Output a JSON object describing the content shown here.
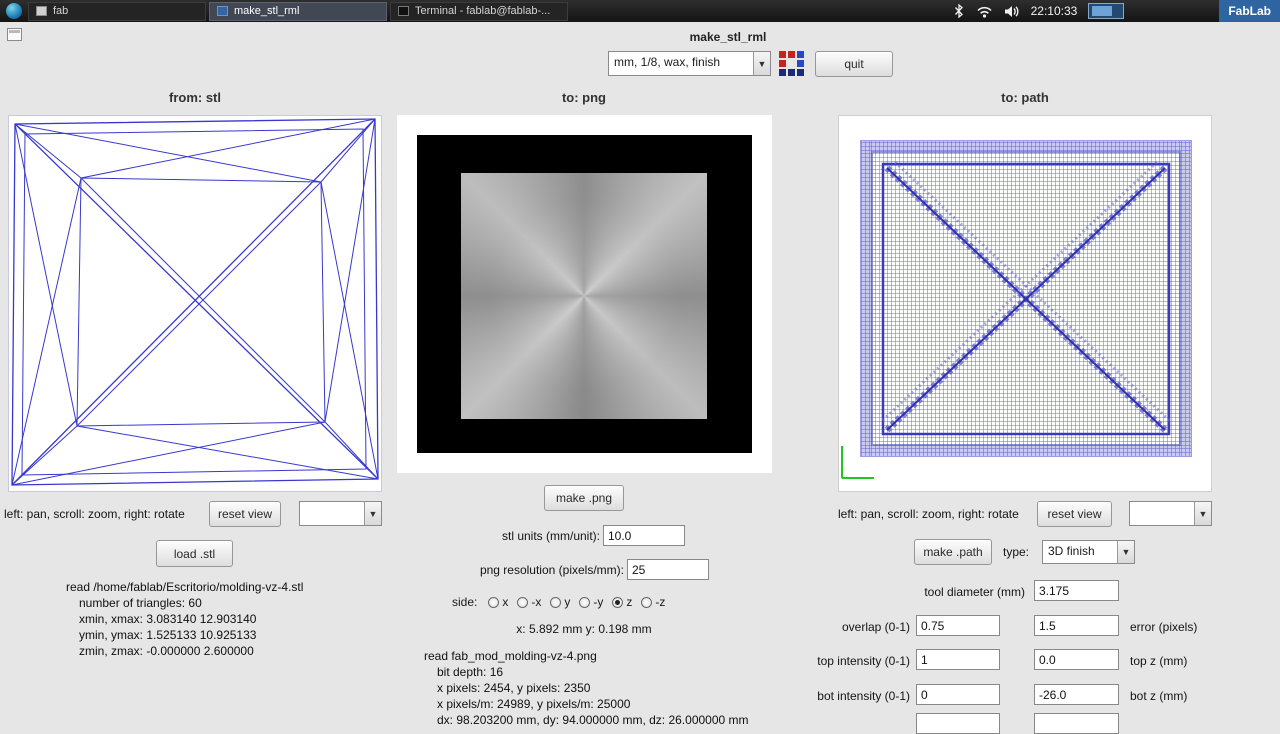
{
  "colors": {
    "accent": "#3465a4",
    "wireframe_blue": "#2323c8",
    "path_blue": "#4a4ac8",
    "selection_blue": "#4a90d9"
  },
  "taskbar": {
    "windows": [
      {
        "label": "fab"
      },
      {
        "label": "make_stl_rml"
      },
      {
        "label": "Terminal - fablab@fablab-..."
      }
    ],
    "clock": "22:10:33",
    "badge": "FabLab"
  },
  "window": {
    "title": "make_stl_rml",
    "preset_value": "mm, 1/8, wax, finish",
    "quit_label": "quit"
  },
  "stl": {
    "header": "from: stl",
    "hint": "left: pan, scroll: zoom, right: rotate",
    "reset_label": "reset view",
    "view_preset_value": "",
    "load_label": "load .stl",
    "info": [
      "read /home/fablab/Escritorio/molding-vz-4.stl",
      "number of triangles: 60",
      "xmin, xmax: 3.083140 12.903140",
      "ymin, ymax: 1.525133 10.925133",
      "zmin, zmax: -0.000000 2.600000"
    ]
  },
  "png": {
    "header": "to: png",
    "make_label": "make .png",
    "units_label": "stl units (mm/unit):",
    "units_value": "10.0",
    "resolution_label": "png resolution (pixels/mm):",
    "resolution_value": "25",
    "side_label": "side:",
    "sides": [
      {
        "label": "x",
        "selected": false
      },
      {
        "label": "-x",
        "selected": false
      },
      {
        "label": "y",
        "selected": false
      },
      {
        "label": "-y",
        "selected": false
      },
      {
        "label": "z",
        "selected": true
      },
      {
        "label": "-z",
        "selected": false
      }
    ],
    "cursor": "x: 5.892 mm  y: 0.198 mm",
    "info": [
      "read fab_mod_molding-vz-4.png",
      "bit depth: 16",
      "x pixels: 2454, y pixels: 2350",
      "x pixels/m: 24989, y pixels/m: 25000",
      "dx: 98.203200 mm, dy: 94.000000 mm, dz: 26.000000 mm"
    ]
  },
  "path": {
    "header": "to: path",
    "hint": "left: pan, scroll: zoom, right: rotate",
    "reset_label": "reset view",
    "view_preset_value": "",
    "make_label": "make .path",
    "type_label": "type:",
    "type_value": "3D finish",
    "tool_label": "tool diameter (mm)",
    "tool_value": "3.175",
    "rows": [
      {
        "label": "overlap (0-1)",
        "value1": "0.75",
        "value2": "1.5",
        "label2": "error (pixels)"
      },
      {
        "label": "top intensity (0-1)",
        "value1": "1",
        "value2": "0.0",
        "label2": "top z (mm)"
      },
      {
        "label": "bot intensity (0-1)",
        "value1": "0",
        "value2": "-26.0",
        "label2": "bot z (mm)"
      }
    ],
    "partial_row": {
      "value1": "",
      "value2": ""
    }
  }
}
